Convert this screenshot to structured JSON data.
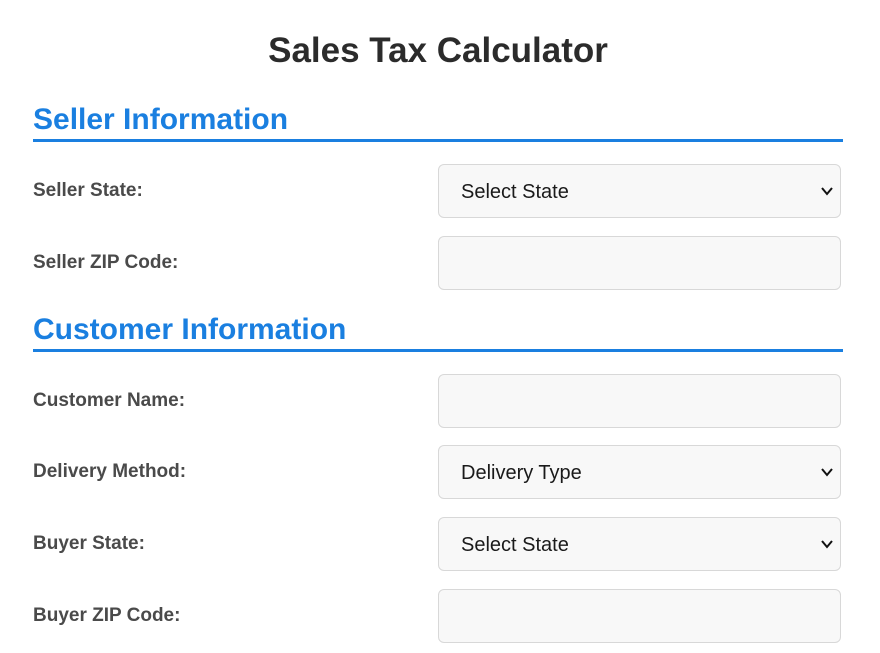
{
  "page": {
    "title": "Sales Tax Calculator"
  },
  "seller": {
    "heading": "Seller Information",
    "state_label": "Seller State:",
    "state_value": "Select State",
    "zip_label": "Seller ZIP Code:",
    "zip_value": ""
  },
  "customer": {
    "heading": "Customer Information",
    "name_label": "Customer Name:",
    "name_value": "",
    "delivery_label": "Delivery Method:",
    "delivery_value": "Delivery Type",
    "buyer_state_label": "Buyer State:",
    "buyer_state_value": "Select State",
    "buyer_zip_label": "Buyer ZIP Code:",
    "buyer_zip_value": ""
  },
  "icons": {
    "dropdown": "chevron-down-icon"
  },
  "colors": {
    "accent": "#1a7fe0",
    "title": "#2b2b2b",
    "label": "#4a4a4a",
    "field_bg": "#f8f8f8",
    "field_border": "#d8d8d8"
  }
}
